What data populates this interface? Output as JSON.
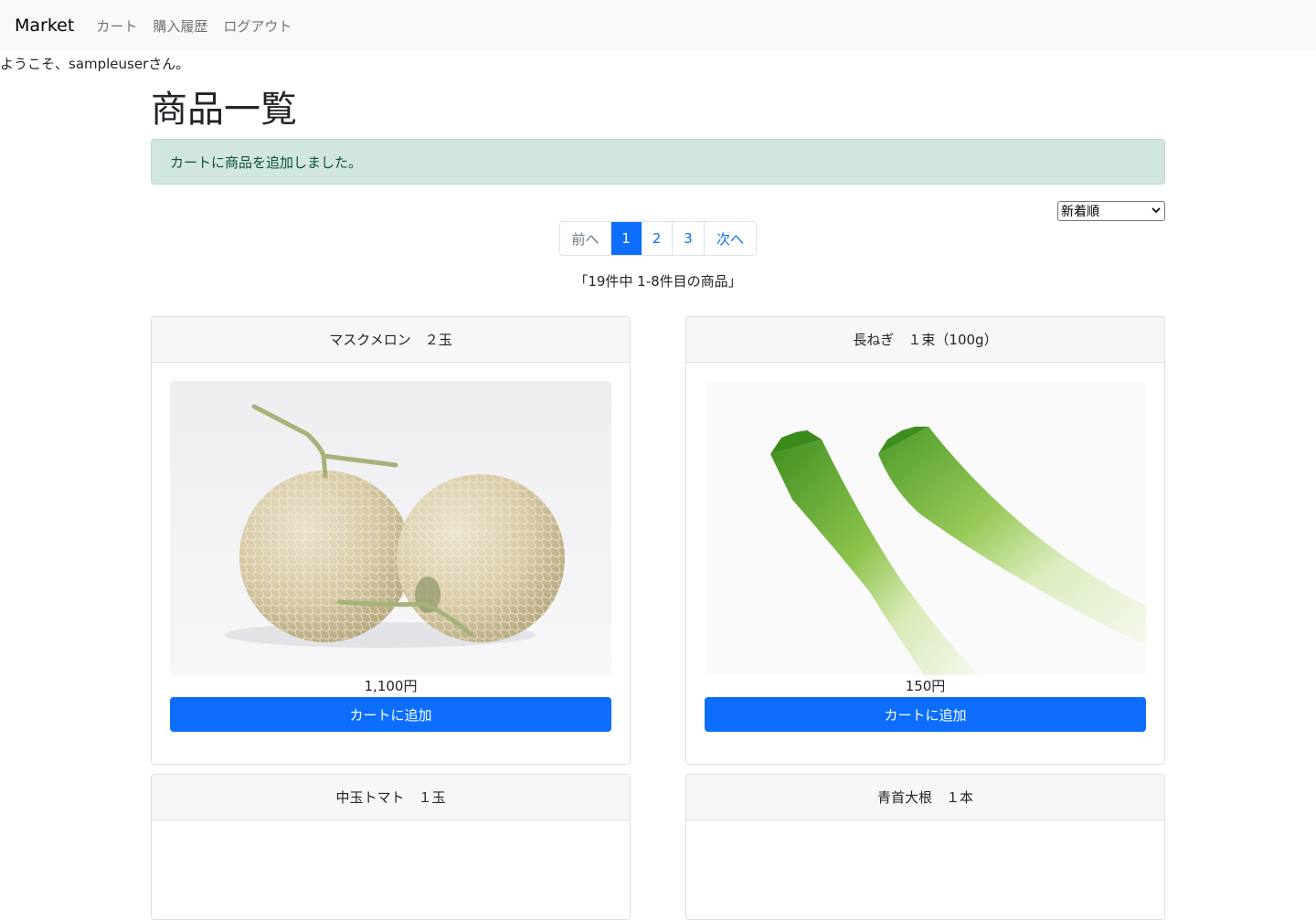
{
  "navbar": {
    "brand": "Market",
    "links": [
      "カート",
      "購入履歴",
      "ログアウト"
    ]
  },
  "welcome": "ようこそ、sampleuserさん。",
  "page_title": "商品一覧",
  "alert": "カートに商品を追加しました。",
  "sort": {
    "selected": "新着順"
  },
  "pagination": {
    "prev": "前へ",
    "pages": [
      "1",
      "2",
      "3"
    ],
    "current": "1",
    "next": "次へ"
  },
  "count_text": "「19件中 1-8件目の商品」",
  "products": [
    {
      "name": "マスクメロン　２玉",
      "price": "1,100円",
      "button": "カートに追加",
      "image": "melon"
    },
    {
      "name": "長ねぎ　１束（100g）",
      "price": "150円",
      "button": "カートに追加",
      "image": "green-onion"
    },
    {
      "name": "中玉トマト　１玉"
    },
    {
      "name": "青首大根　１本"
    }
  ],
  "colors": {
    "primary": "#0d6efd",
    "navbar_bg": "#f8f9fa",
    "alert_bg": "#d1e7dd",
    "alert_text": "#0f5132"
  }
}
